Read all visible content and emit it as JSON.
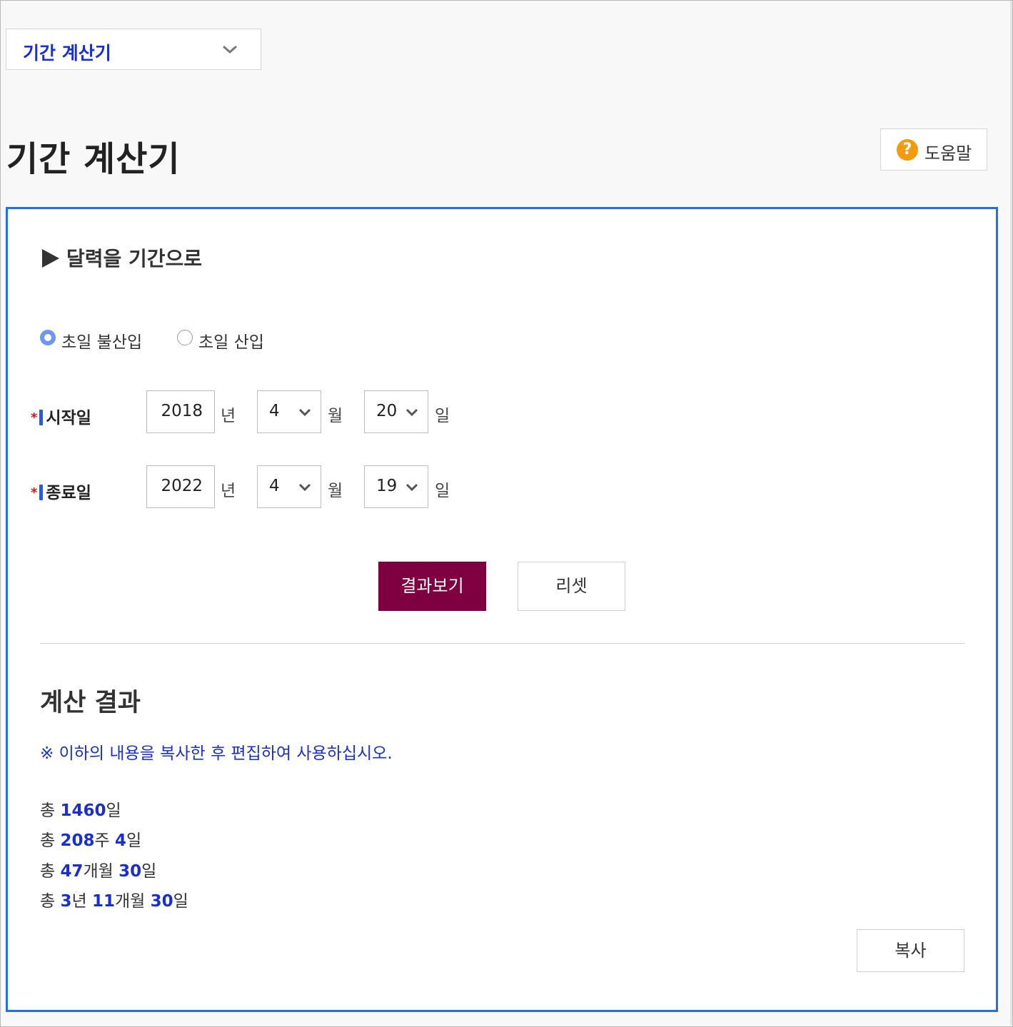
{
  "nav": {
    "dropdown_label": "기간 계산기"
  },
  "page": {
    "title": "기간 계산기",
    "help_label": "도움말",
    "help_icon": "?"
  },
  "section": {
    "heading": "달력을 기간으로"
  },
  "options": [
    {
      "label": "초일 불산입",
      "selected": true
    },
    {
      "label": "초일 산입",
      "selected": false
    }
  ],
  "start": {
    "label": "시작일",
    "year": "2018",
    "month": "4",
    "day": "20"
  },
  "end": {
    "label": "종료일",
    "year": "2022",
    "month": "4",
    "day": "19"
  },
  "units": {
    "year": "년",
    "month": "월",
    "day": "일"
  },
  "required_mark": "*",
  "buttons": {
    "calculate": "결과보기",
    "reset": "리셋",
    "copy": "복사"
  },
  "result": {
    "title": "계산 결과",
    "notice": "※ 이하의 내용을 복사한 후 편집하여 사용하십시오.",
    "prefix": "총",
    "total_days": "1460",
    "weeks": "208",
    "weeks_rem_days": "4",
    "months": "47",
    "months_rem_days": "30",
    "years": "3",
    "years_months": "11",
    "years_rem_days": "30",
    "unit_day": "일",
    "unit_week": "주",
    "unit_month": "개월",
    "unit_year": "년"
  },
  "colors": {
    "accent_blue": "#1a2fd1",
    "panel_border": "#1f6ff0",
    "primary_button": "#7e0040",
    "help_icon": "#f39b10",
    "required": "#e01010"
  }
}
